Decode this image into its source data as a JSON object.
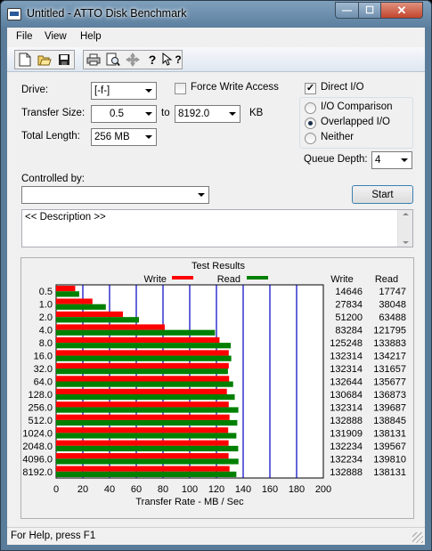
{
  "window": {
    "title": "Untitled - ATTO Disk Benchmark",
    "minimize_glyph": "—",
    "maximize_glyph": "☐",
    "close_glyph": "✕"
  },
  "menu": [
    {
      "label": "File"
    },
    {
      "label": "View"
    },
    {
      "label": "Help"
    }
  ],
  "toolbar": {
    "buttons": [
      "new-icon",
      "open-icon",
      "save-icon",
      "print-icon",
      "print-preview-icon",
      "move-icon",
      "help-icon",
      "context-help-icon"
    ],
    "help_glyph": "?",
    "context_help_glyph": "?"
  },
  "settings": {
    "drive_label": "Drive:",
    "drive_value": "[-f-]",
    "force_write_label": "Force Write Access",
    "force_write_checked": false,
    "direct_io_label": "Direct I/O",
    "direct_io_checked": true,
    "direct_io_mark": "✓",
    "transfer_size_label": "Transfer Size:",
    "transfer_from": "0.5",
    "to_label": "to",
    "transfer_to": "8192.0",
    "kb_label": "KB",
    "total_length_label": "Total Length:",
    "total_length_value": "256 MB",
    "io_mode_options": [
      "I/O Comparison",
      "Overlapped I/O",
      "Neither"
    ],
    "io_mode_selected": "Overlapped I/O",
    "queue_depth_label": "Queue Depth:",
    "queue_depth_value": "4",
    "controlled_by_label": "Controlled by:",
    "controlled_by_value": "",
    "start_button": "Start",
    "description_text": "<< Description >>"
  },
  "results": {
    "title": "Test Results",
    "write_legend": "Write",
    "read_legend": "Read",
    "write_col_header": "Write",
    "read_col_header": "Read",
    "write_color": "#ff0000",
    "read_color": "#008000"
  },
  "chart_data": {
    "type": "bar",
    "orientation": "horizontal",
    "title": "Test Results",
    "xlabel": "Transfer Rate - MB / Sec",
    "ylabel": "",
    "xlim": [
      0,
      200
    ],
    "x_ticks": [
      "0",
      "20",
      "40",
      "60",
      "80",
      "100",
      "120",
      "140",
      "160",
      "180",
      "200"
    ],
    "categories": [
      "0.5",
      "1.0",
      "2.0",
      "4.0",
      "8.0",
      "16.0",
      "32.0",
      "64.0",
      "128.0",
      "256.0",
      "512.0",
      "1024.0",
      "2048.0",
      "4096.0",
      "8192.0"
    ],
    "series": [
      {
        "name": "Write",
        "values": [
          14.3,
          27.2,
          50.0,
          81.3,
          122.3,
          129.2,
          129.2,
          129.5,
          127.8,
          129.2,
          129.8,
          128.8,
          129.1,
          129.1,
          129.8
        ]
      },
      {
        "name": "Read",
        "values": [
          17.3,
          37.2,
          62.0,
          118.9,
          130.7,
          131.1,
          128.6,
          132.5,
          133.7,
          136.4,
          135.6,
          134.9,
          136.3,
          136.5,
          134.9
        ]
      }
    ],
    "write_raw": [
      "14646",
      "27834",
      "51200",
      "83284",
      "125248",
      "132314",
      "132314",
      "132644",
      "130684",
      "132314",
      "132888",
      "131909",
      "132234",
      "132234",
      "132888"
    ],
    "read_raw": [
      "17747",
      "38048",
      "63488",
      "121795",
      "133883",
      "134217",
      "131657",
      "135677",
      "136873",
      "139687",
      "138845",
      "138131",
      "139567",
      "139810",
      "138131"
    ],
    "legend": "top",
    "grid": true
  },
  "status": {
    "text": "For Help, press F1"
  }
}
